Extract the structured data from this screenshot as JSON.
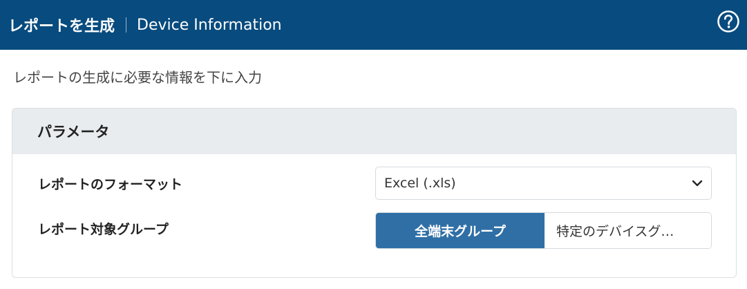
{
  "header": {
    "title": "レポートを生成",
    "subtitle": "Device Information",
    "help_icon": "help-circle-icon"
  },
  "intro_text": "レポートの生成に必要な情報を下に入力",
  "panel": {
    "title": "パラメータ",
    "format": {
      "label": "レポートのフォーマット",
      "selected": "Excel (.xls)",
      "icon": "chevron-down-icon"
    },
    "target_group": {
      "label": "レポート対象グループ",
      "options": [
        "全端末グループ",
        "特定のデバイスグ…"
      ],
      "selected_index": 0
    }
  },
  "colors": {
    "header_bg": "#084b7e",
    "accent": "#2f6fa6",
    "panel_head_bg": "#e9ecee"
  }
}
